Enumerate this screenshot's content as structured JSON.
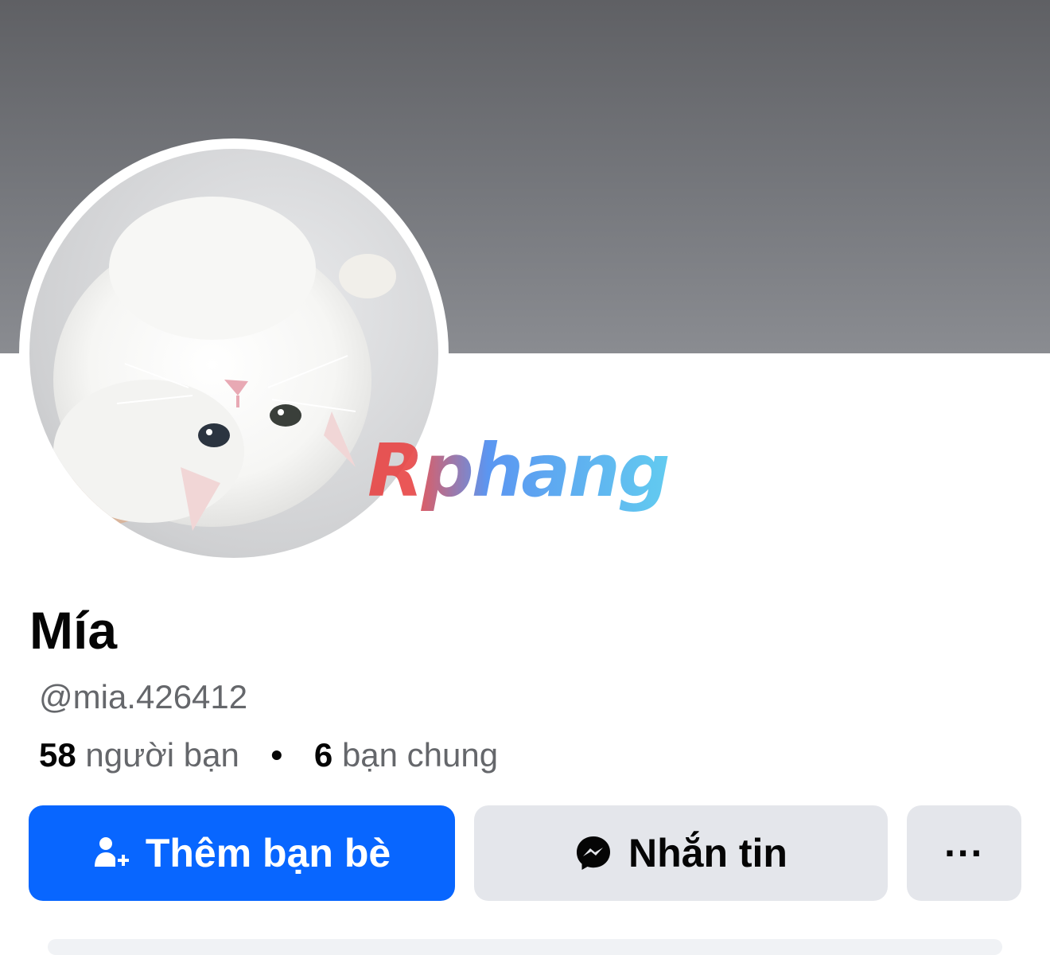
{
  "profile": {
    "name": "Mía",
    "username": "@mia.426412",
    "friends_count": "58",
    "friends_label": "người bạn",
    "separator": "•",
    "mutual_count": "6",
    "mutual_label": "bạn chung"
  },
  "actions": {
    "add_friend_label": "Thêm bạn bè",
    "message_label": "Nhắn tin",
    "more_label": "···"
  },
  "watermark": {
    "text": "Rphang"
  },
  "icons": {
    "add_friend": "person-add-icon",
    "message": "messenger-icon",
    "more": "more-dots-icon"
  },
  "colors": {
    "primary_button": "#0866ff",
    "secondary_button": "#e4e6eb",
    "text_primary": "#050505",
    "text_secondary": "#65676b",
    "cover": "#6b6c70"
  }
}
